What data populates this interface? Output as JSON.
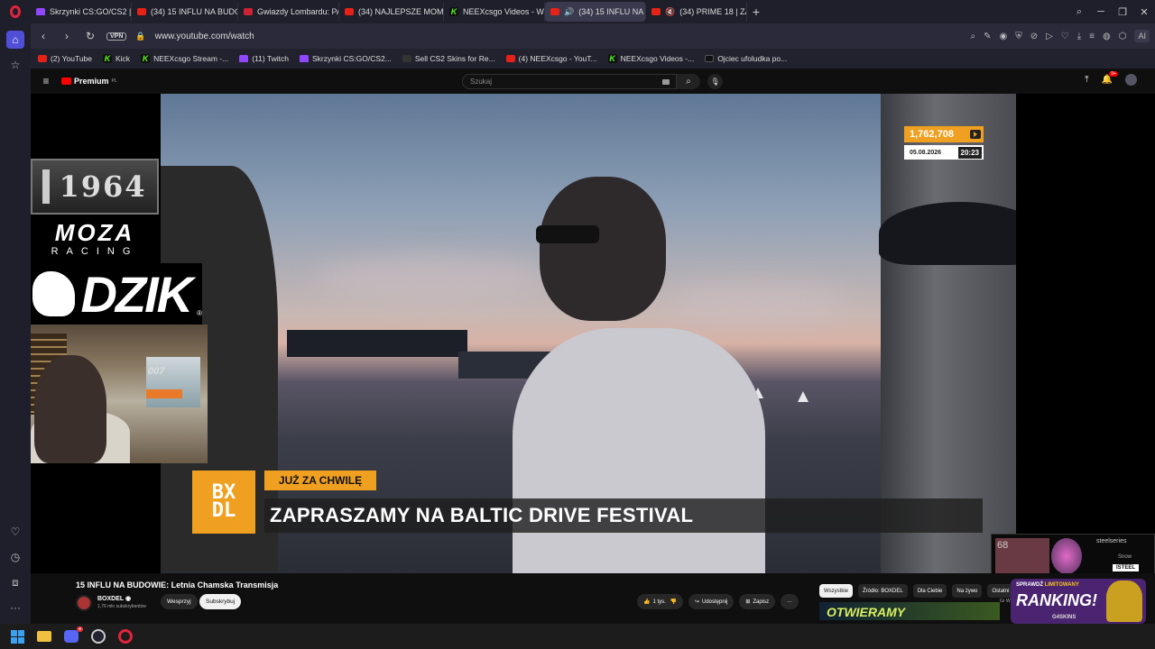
{
  "browser": {
    "tabs": [
      {
        "label": "Skrzynki CS:GO/CS2 | G4S",
        "favicon": "gem-icon"
      },
      {
        "label": "(34) 15 INFLU NA BUDOW",
        "favicon": "youtube-icon"
      },
      {
        "label": "Gwiazdy Lombardu: PACZ",
        "favicon": "youtube-icon"
      },
      {
        "label": "(34) NAJLEPSZE MOMENT",
        "favicon": "youtube-icon"
      },
      {
        "label": "NEEXcsgo Videos - Watch",
        "favicon": "kick-icon"
      },
      {
        "label": "(34) 15 INFLU NA BUD",
        "favicon": "youtube-icon",
        "active": true
      },
      {
        "label": "(34) PRIME 18 | ZADYM",
        "favicon": "youtube-icon"
      }
    ],
    "new_tab": "+",
    "vpn": "VPN",
    "url": "www.youtube.com/watch",
    "ai_label": "AI",
    "bookmarks": [
      {
        "label": "(2) YouTube",
        "icon": "youtube-icon"
      },
      {
        "label": "Kick",
        "icon": "kick-icon"
      },
      {
        "label": "NEEXcsgo Stream -...",
        "icon": "kick-icon"
      },
      {
        "label": "(11) Twitch",
        "icon": "twitch-icon"
      },
      {
        "label": "Skrzynki CS:GO/CS2...",
        "icon": "gem-icon"
      },
      {
        "label": "Sell CS2 Skins for Re...",
        "icon": "skin-icon"
      },
      {
        "label": "(4) NEEXcsgo - YouT...",
        "icon": "youtube-icon"
      },
      {
        "label": "NEEXcsgo Videos -...",
        "icon": "kick-icon"
      },
      {
        "label": "Ojciec ufoludka po...",
        "icon": "tiktok-icon"
      }
    ]
  },
  "youtube": {
    "logo": "Premium",
    "logo_country": "PL",
    "search_placeholder": "Szukaj",
    "notif_count": "9+"
  },
  "video_overlay": {
    "views": "1,762,708",
    "date": "05.08.2026",
    "time": "20:23",
    "logo_1964": "1964",
    "moza_top": "MOZA",
    "moza_bottom": "RACING",
    "dzik": "DZIK",
    "dzik_reg": "®",
    "webcam_sign": "007",
    "bx_logo_top": "BX",
    "bx_logo_bottom": "DL",
    "soon_tag": "JUŻ ZA CHWILĘ",
    "headline": "ZAPRASZAMY NA BALTIC DRIVE FESTIVAL",
    "steelseries_key": "68",
    "steelseries": "steelseries",
    "steelseries_snow": "Snow",
    "steelseries_tag": "ISTEEL"
  },
  "video_info": {
    "title": "15 INFLU NA BUDOWIE: Letnia Chamska Transmisja",
    "channel": "BOXDEL",
    "subscribers": "1,76 mln subskrybentów",
    "support_button": "Wesprzyj",
    "subscribe_button": "Subskrybuj",
    "like_count": "1 tys.",
    "share": "Udostępnij",
    "save": "Zapisz",
    "more": "···"
  },
  "recommend_chips": [
    "Wszystkie",
    "Źródło: BOXDEL",
    "Dla Ciebie",
    "Na żywo",
    "Ostatni"
  ],
  "recommend_thumb": "OTWIERAMY",
  "recommend_side": "Gr\nWIDZ",
  "ad": {
    "line1_a": "SPRAWDŹ",
    "line1_b": "LIMITOWANY",
    "line2": "RANKING!",
    "brand": "G4SKINS"
  },
  "colors": {
    "accent_orange": "#f0a020",
    "youtube_red": "#ff0000",
    "opera_red": "#e0243b",
    "sidebar_active": "#4f4fd8"
  }
}
